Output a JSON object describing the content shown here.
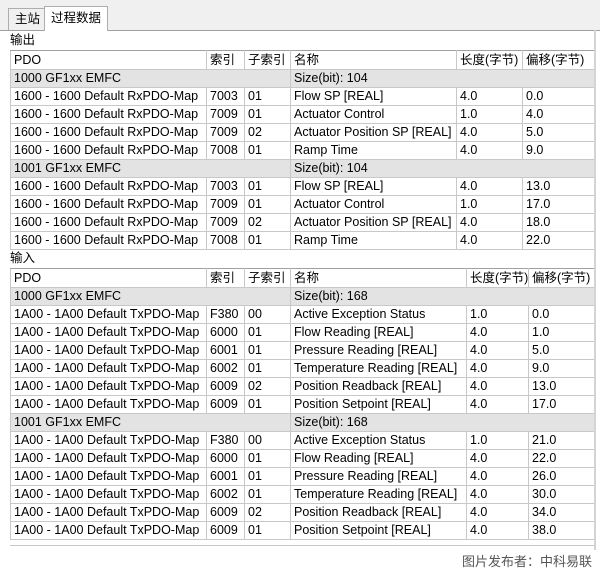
{
  "tabs": [
    "主站",
    "过程数据"
  ],
  "outputs": {
    "label": "输出",
    "headers": [
      "PDO",
      "索引",
      "子索引",
      "名称",
      "长度(字节)",
      "偏移(字节)"
    ],
    "groups": [
      {
        "name": "1000  GF1xx EMFC",
        "size": "Size(bit): 104",
        "rows": [
          [
            "1600 - 1600 Default RxPDO-Map",
            "7003",
            "01",
            "Flow SP [REAL]",
            "4.0",
            "0.0"
          ],
          [
            "1600 - 1600 Default RxPDO-Map",
            "7009",
            "01",
            "Actuator Control",
            "1.0",
            "4.0"
          ],
          [
            "1600 - 1600 Default RxPDO-Map",
            "7009",
            "02",
            "Actuator Position SP [REAL]",
            "4.0",
            "5.0"
          ],
          [
            "1600 - 1600 Default RxPDO-Map",
            "7008",
            "01",
            "Ramp Time",
            "4.0",
            "9.0"
          ]
        ]
      },
      {
        "name": "1001  GF1xx EMFC",
        "size": "Size(bit): 104",
        "rows": [
          [
            "1600 - 1600 Default RxPDO-Map",
            "7003",
            "01",
            "Flow SP [REAL]",
            "4.0",
            "13.0"
          ],
          [
            "1600 - 1600 Default RxPDO-Map",
            "7009",
            "01",
            "Actuator Control",
            "1.0",
            "17.0"
          ],
          [
            "1600 - 1600 Default RxPDO-Map",
            "7009",
            "02",
            "Actuator Position SP [REAL]",
            "4.0",
            "18.0"
          ],
          [
            "1600 - 1600 Default RxPDO-Map",
            "7008",
            "01",
            "Ramp Time",
            "4.0",
            "22.0"
          ]
        ]
      }
    ]
  },
  "inputs": {
    "label": "输入",
    "headers": [
      "PDO",
      "索引",
      "子索引",
      "名称",
      "长度(字节)",
      "偏移(字节)"
    ],
    "groups": [
      {
        "name": "1000  GF1xx EMFC",
        "size": "Size(bit): 168",
        "rows": [
          [
            "1A00 - 1A00 Default TxPDO-Map",
            "F380",
            "00",
            "Active Exception Status",
            "1.0",
            "0.0"
          ],
          [
            "1A00 - 1A00 Default TxPDO-Map",
            "6000",
            "01",
            "Flow Reading [REAL]",
            "4.0",
            "1.0"
          ],
          [
            "1A00 - 1A00 Default TxPDO-Map",
            "6001",
            "01",
            "Pressure Reading [REAL]",
            "4.0",
            "5.0"
          ],
          [
            "1A00 - 1A00 Default TxPDO-Map",
            "6002",
            "01",
            "Temperature Reading [REAL]",
            "4.0",
            "9.0"
          ],
          [
            "1A00 - 1A00 Default TxPDO-Map",
            "6009",
            "02",
            "Position Readback [REAL]",
            "4.0",
            "13.0"
          ],
          [
            "1A00 - 1A00 Default TxPDO-Map",
            "6009",
            "01",
            "Position Setpoint [REAL]",
            "4.0",
            "17.0"
          ]
        ]
      },
      {
        "name": "1001  GF1xx EMFC",
        "size": "Size(bit): 168",
        "rows": [
          [
            "1A00 - 1A00 Default TxPDO-Map",
            "F380",
            "00",
            "Active Exception Status",
            "1.0",
            "21.0"
          ],
          [
            "1A00 - 1A00 Default TxPDO-Map",
            "6000",
            "01",
            "Flow Reading [REAL]",
            "4.0",
            "22.0"
          ],
          [
            "1A00 - 1A00 Default TxPDO-Map",
            "6001",
            "01",
            "Pressure Reading [REAL]",
            "4.0",
            "26.0"
          ],
          [
            "1A00 - 1A00 Default TxPDO-Map",
            "6002",
            "01",
            "Temperature Reading [REAL]",
            "4.0",
            "30.0"
          ],
          [
            "1A00 - 1A00 Default TxPDO-Map",
            "6009",
            "02",
            "Position Readback [REAL]",
            "4.0",
            "34.0"
          ],
          [
            "1A00 - 1A00 Default TxPDO-Map",
            "6009",
            "01",
            "Position Setpoint [REAL]",
            "4.0",
            "38.0"
          ]
        ]
      }
    ]
  },
  "watermark": "图片发布者：中科易联"
}
